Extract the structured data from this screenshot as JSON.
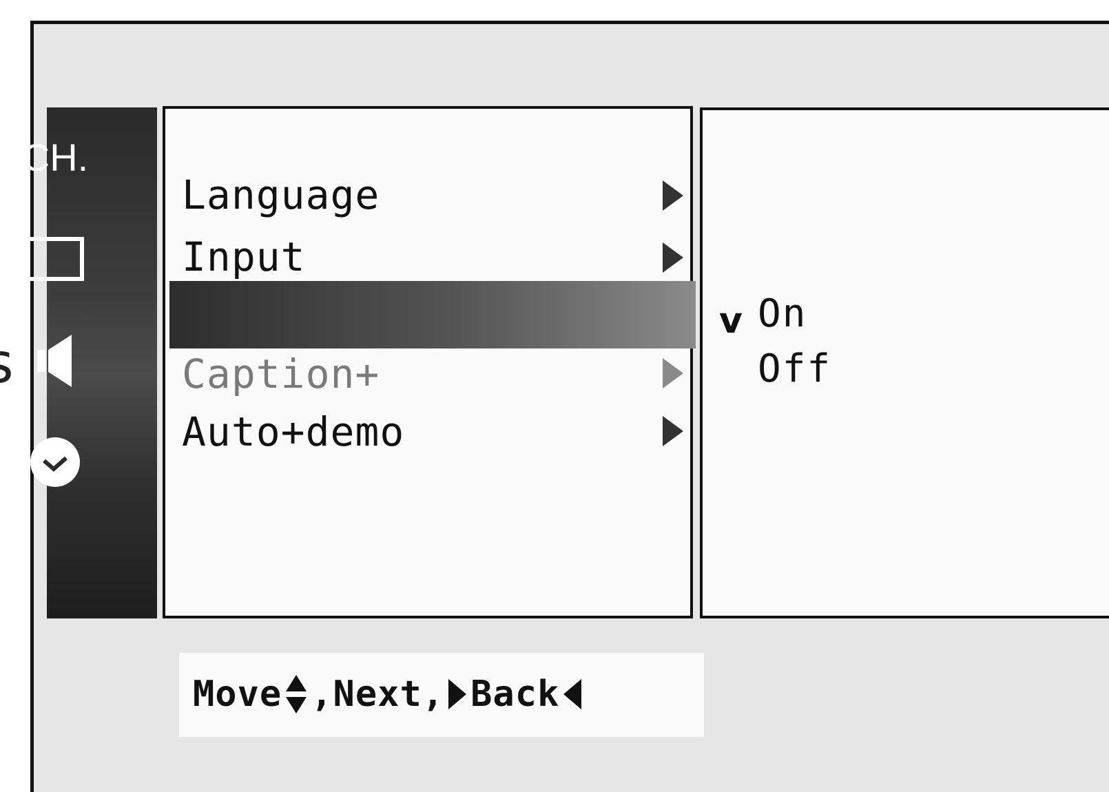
{
  "sidebar": {
    "items": [
      {
        "label": "CH.",
        "icon": "channel-icon"
      },
      {
        "icon": "screen-icon"
      },
      {
        "icon": "speaker-icon"
      },
      {
        "icon": "clock-icon"
      }
    ]
  },
  "menu": {
    "items": [
      {
        "label": "Language",
        "has_submenu": true
      },
      {
        "label": "Input",
        "has_submenu": true
      },
      {
        "label": "",
        "selected": true
      },
      {
        "label": "Caption+",
        "has_submenu": true
      },
      {
        "label": "Auto+demo",
        "has_submenu": true
      }
    ]
  },
  "submenu": {
    "options": [
      {
        "label": "On",
        "checked": true
      },
      {
        "label": "Off",
        "checked": false
      }
    ],
    "check_mark": "v"
  },
  "hint": {
    "move": "Move",
    "sep1": ",",
    "next": "Next",
    "sep2": ",",
    "back": "Back"
  },
  "colors": {
    "highlight": "#555555",
    "panel": "#fafafa",
    "frame": "#e6e6e6"
  }
}
